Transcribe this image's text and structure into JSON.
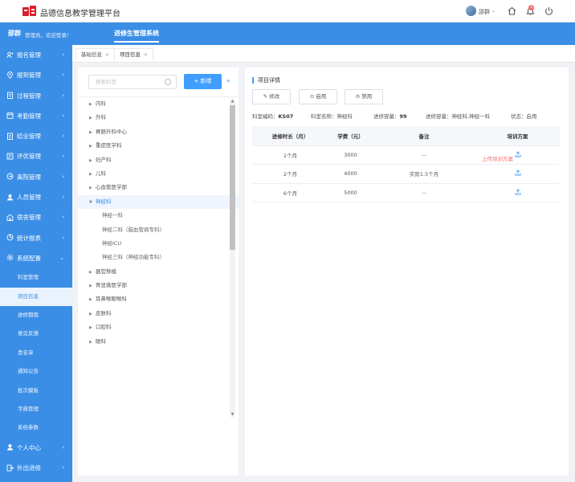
{
  "app": {
    "title": "品德信息教学管理平台"
  },
  "header": {
    "user_name": "邵群",
    "notification_count": "3"
  },
  "banner": {
    "username": "邵群",
    "welcome": "管理员，欢迎登录!",
    "module": "进修生管理系统"
  },
  "sidebar": {
    "items": [
      {
        "label": "报名管理"
      },
      {
        "label": "报到管理"
      },
      {
        "label": "过程管理"
      },
      {
        "label": "考勤管理"
      },
      {
        "label": "结业管理"
      },
      {
        "label": "评优管理"
      },
      {
        "label": "离院管理"
      },
      {
        "label": "人员管理"
      },
      {
        "label": "宿舍管理"
      },
      {
        "label": "统计报表"
      },
      {
        "label": "系统配置"
      }
    ],
    "sub_items": [
      {
        "label": "科室管理"
      },
      {
        "label": "项目信息"
      },
      {
        "label": "进修期南"
      },
      {
        "label": "意见反馈"
      },
      {
        "label": "黑名单"
      },
      {
        "label": "通知公告"
      },
      {
        "label": "批次模板"
      },
      {
        "label": "字典管理"
      },
      {
        "label": "系统参数"
      }
    ],
    "bottom_items": [
      {
        "label": "个人中心"
      },
      {
        "label": "外出进修"
      }
    ]
  },
  "tabs": [
    {
      "label": "基础信息"
    },
    {
      "label": "项目信息"
    }
  ],
  "left": {
    "search_placeholder": "搜索科室",
    "add_label": "+ 新增",
    "tree": [
      {
        "label": "内科"
      },
      {
        "label": "外科"
      },
      {
        "label": "胃肠外科中心"
      },
      {
        "label": "重症医学科"
      },
      {
        "label": "妇产科"
      },
      {
        "label": "儿科"
      },
      {
        "label": "心血管医学部"
      },
      {
        "label": "神经科"
      },
      {
        "label": "神经一科"
      },
      {
        "label": "神经二科（脑血管病专科）"
      },
      {
        "label": "神经ICU"
      },
      {
        "label": "神经三科（神经功能专科）"
      },
      {
        "label": "器官移植"
      },
      {
        "label": "骨显微医学部"
      },
      {
        "label": "耳鼻喉眼喉科"
      },
      {
        "label": "皮肤科"
      },
      {
        "label": "口腔科"
      },
      {
        "label": "眼科"
      }
    ]
  },
  "detail": {
    "title": "项目详情",
    "buttons": {
      "edit": "修改",
      "enable": "启用",
      "disable": "禁用"
    },
    "info": {
      "code_label": "科室编码：",
      "code": "KS07",
      "name_label": "科室名称：",
      "name": "神经科",
      "capacity_label": "进修容量：",
      "capacity": "99",
      "capacity2_label": "进修容量：",
      "capacity2": "神经科,神经一科",
      "status_label": "状态：",
      "status": "启用"
    },
    "table": {
      "headers": [
        "进修时长（月）",
        "学费（元）",
        "备注",
        "培训方案"
      ],
      "rows": [
        {
          "duration": "1个月",
          "fee": "3000",
          "note": "--"
        },
        {
          "duration": "2个月",
          "fee": "4000",
          "note": "实际1.5个月"
        },
        {
          "duration": "6个月",
          "fee": "5000",
          "note": "--"
        }
      ],
      "upload_tooltip": "上传培训方案"
    }
  }
}
